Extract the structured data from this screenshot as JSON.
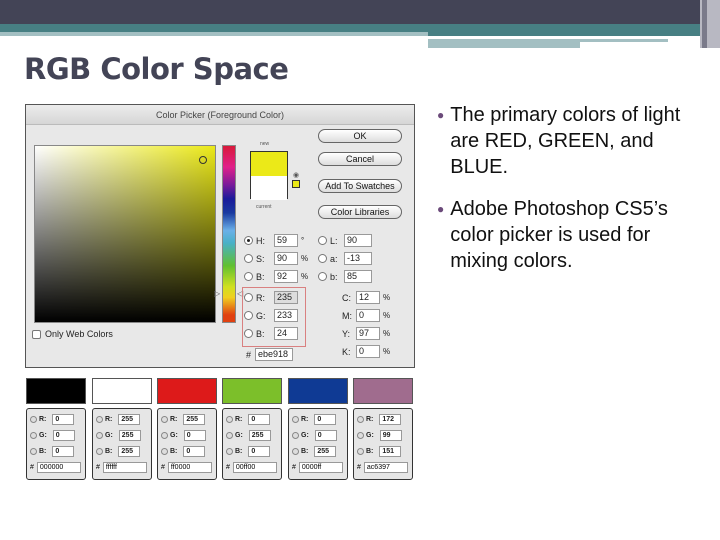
{
  "slide": {
    "title": "RGB Color Space",
    "bullets": [
      "The primary colors of light are RED, GREEN, and BLUE.",
      "Adobe Photoshop CS5’s color picker is used for mixing colors."
    ]
  },
  "picker": {
    "window_title": "Color Picker (Foreground Color)",
    "new_label": "new",
    "current_label": "current",
    "new_color": "#ebe918",
    "current_color": "#ffffff",
    "buttons": {
      "ok": "OK",
      "cancel": "Cancel",
      "add_swatches": "Add To Swatches",
      "libraries": "Color Libraries"
    },
    "only_web_colors": "Only Web Colors",
    "fields": {
      "H": {
        "label": "H:",
        "value": "59",
        "unit": "°",
        "selected": true
      },
      "S": {
        "label": "S:",
        "value": "90",
        "unit": "%"
      },
      "Bv": {
        "label": "B:",
        "value": "92",
        "unit": "%"
      },
      "R": {
        "label": "R:",
        "value": "235"
      },
      "G": {
        "label": "G:",
        "value": "233"
      },
      "B": {
        "label": "B:",
        "value": "24"
      },
      "L": {
        "label": "L:",
        "value": "90"
      },
      "a": {
        "label": "a:",
        "value": "-13"
      },
      "b": {
        "label": "b:",
        "value": "85"
      },
      "C": {
        "label": "C:",
        "value": "12",
        "unit": "%"
      },
      "M": {
        "label": "M:",
        "value": "0",
        "unit": "%"
      },
      "Y": {
        "label": "Y:",
        "value": "97",
        "unit": "%"
      },
      "K": {
        "label": "K:",
        "value": "0",
        "unit": "%"
      },
      "hex_label": "#",
      "hex": "ebe918"
    }
  },
  "swatches": [
    {
      "color": "#000000",
      "r": "0",
      "g": "0",
      "b": "0",
      "hex": "000000"
    },
    {
      "color": "#ffffff",
      "r": "255",
      "g": "255",
      "b": "255",
      "hex": "ffffff"
    },
    {
      "color": "#dd1a1a",
      "r": "255",
      "g": "0",
      "b": "0",
      "hex": "ff0000"
    },
    {
      "color": "#7cbf2a",
      "r": "0",
      "g": "255",
      "b": "0",
      "hex": "00ff00"
    },
    {
      "color": "#0f3a94",
      "r": "0",
      "g": "0",
      "b": "255",
      "hex": "0000ff"
    },
    {
      "color": "#a06c8e",
      "r": "172",
      "g": "99",
      "b": "151",
      "hex": "ac6397"
    }
  ],
  "swatch_labels": {
    "r": "R:",
    "g": "G:",
    "b": "B:",
    "hash": "#"
  }
}
